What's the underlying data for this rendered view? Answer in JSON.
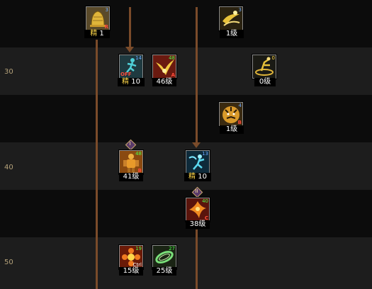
{
  "level_rows": [
    "30",
    "40",
    "50"
  ],
  "skills": [
    {
      "id": "bell",
      "icon": "golden-bell-icon",
      "level": "3",
      "grade": "R",
      "caption_prefix": "精",
      "caption_value": "1"
    },
    {
      "id": "swirl1",
      "icon": "golden-swirl-icon",
      "level": "3",
      "grade": "",
      "caption_value": "1级"
    },
    {
      "id": "off",
      "icon": "running-figure-icon",
      "level": "14",
      "grade": "",
      "off": "OFF",
      "caption_prefix": "精",
      "caption_value": "10"
    },
    {
      "id": "bird",
      "icon": "golden-bird-icon",
      "level": "48",
      "grade": "A",
      "caption_value": "46级"
    },
    {
      "id": "swirl2",
      "icon": "kick-swirl-icon",
      "level": "0",
      "grade": "",
      "caption_value": "0级"
    },
    {
      "id": "tiger",
      "icon": "tiger-face-icon",
      "level": "4",
      "grade": "B",
      "caption_value": "1级"
    },
    {
      "id": "giant",
      "icon": "armored-giant-icon",
      "level": "48",
      "grade": "B",
      "caption_value": "41级",
      "roman": "I"
    },
    {
      "id": "cyan",
      "icon": "cyan-runner-icon",
      "level": "13",
      "grade": "",
      "caption_prefix": "精",
      "caption_value": "10"
    },
    {
      "id": "phoenix",
      "icon": "fire-phoenix-icon",
      "level": "40",
      "grade": "C",
      "caption_value": "38级",
      "roman": "II"
    },
    {
      "id": "flower",
      "icon": "fire-flower-icon",
      "level": "19",
      "grade": "",
      "ctrl": "Ctrl",
      "caption_value": "15级"
    },
    {
      "id": "ring",
      "icon": "green-ring-icon",
      "level": "27",
      "grade": "",
      "caption_value": "25级"
    }
  ],
  "colors": {
    "level_green": "#4dff4d",
    "level_blue": "#6aa8ff",
    "grade_red": "#ff4a3a",
    "jing": "#ffd84a",
    "connector": "#7a4b2a"
  }
}
